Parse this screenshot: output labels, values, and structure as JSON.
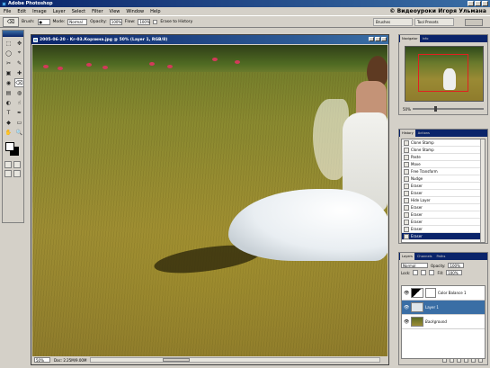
{
  "window": {
    "title": "Adobe Photoshop"
  },
  "menu": {
    "items": [
      "File",
      "Edit",
      "Image",
      "Layer",
      "Select",
      "Filter",
      "View",
      "Window",
      "Help"
    ],
    "watermark": "© Видеоуроки Игоря Ульмана"
  },
  "options": {
    "brush_label": "Brush:",
    "mode_label": "Mode:",
    "mode_value": "Normal",
    "opacity_label": "Opacity:",
    "opacity_value": "100%",
    "flow_label": "Flow:",
    "flow_value": "100%",
    "history_label": "Erase to History",
    "right_tabs": [
      "Brushes",
      "Tool Presets"
    ]
  },
  "tools": [
    "⬚",
    "✥",
    "◯",
    "⌖",
    "✂",
    "✎",
    "▣",
    "✚",
    "◉",
    "⌫",
    "▤",
    "◍",
    "◐",
    "☝",
    "T",
    "✒",
    "◆",
    "▭",
    "✋",
    "🔍"
  ],
  "document": {
    "title": "2005-06-20 - Kr-03.Корзина.jpg @ 50% (Layer 1, RGB/8)",
    "zoom": "50%",
    "doc_info": "Doc: 2.25M/9.00M"
  },
  "navigator": {
    "tabs": [
      "Navigator",
      "Info"
    ],
    "zoom_value": "50%"
  },
  "history": {
    "tabs": [
      "History",
      "Actions"
    ],
    "items": [
      "Clone Stamp",
      "Clone Stamp",
      "Paste",
      "Move",
      "Free Transform",
      "Nudge",
      "Eraser",
      "Eraser",
      "Hide Layer",
      "Eraser",
      "Eraser",
      "Eraser",
      "Eraser",
      "Eraser"
    ],
    "selected_index": 13
  },
  "layers": {
    "tabs": [
      "Layers",
      "Channels",
      "Paths"
    ],
    "blend_mode": "Normal",
    "opacity_label": "Opacity:",
    "opacity_value": "100%",
    "lock_label": "Lock:",
    "fill_label": "Fill:",
    "fill_value": "100%",
    "rows": [
      {
        "name": "Color Balance 1",
        "kind": "adjustment"
      },
      {
        "name": "Layer 1",
        "kind": "pixel",
        "selected": true
      },
      {
        "name": "Background",
        "kind": "background"
      }
    ]
  },
  "colors": {
    "title_bar": "#0a246a",
    "chrome": "#d4d0c8",
    "selection": "#3a6ea5"
  }
}
